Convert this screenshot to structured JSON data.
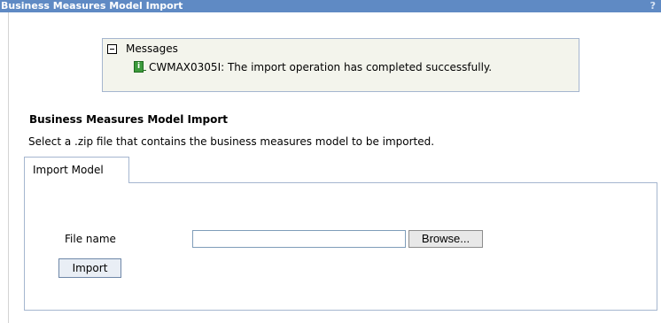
{
  "titlebar": {
    "title": "Business Measures Model Import",
    "help": "?"
  },
  "messages": {
    "header": "Messages",
    "items": [
      {
        "icon": "info-icon",
        "icon_glyph": "i",
        "text": "CWMAX0305I: The import operation has completed successfully."
      }
    ]
  },
  "section": {
    "title": "Business Measures Model Import",
    "instruction": "Select a .zip file that contains the business measures model to be imported."
  },
  "tabs": [
    {
      "label": "Import Model",
      "selected": true
    }
  ],
  "form": {
    "file_label": "File name",
    "file_value": "",
    "browse_label": "Browse...",
    "import_label": "Import"
  },
  "colors": {
    "titlebar_bg": "#5f8ac4",
    "message_box_bg": "#f3f4ec",
    "border": "#a5b6cf",
    "info_icon": "#3c9a3c"
  }
}
